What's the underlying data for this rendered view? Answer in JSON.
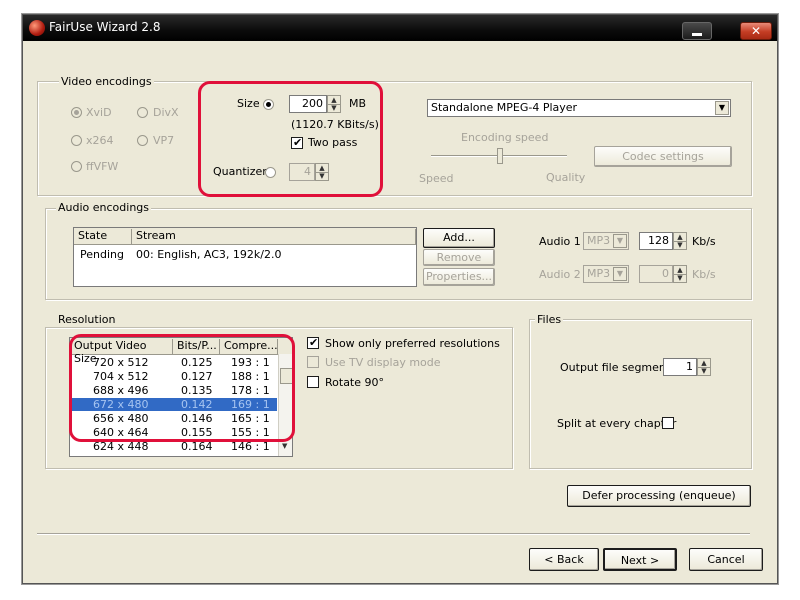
{
  "window": {
    "title": "FairUse Wizard 2.8"
  },
  "video": {
    "group_label": "Video encodings",
    "codecs": [
      {
        "label": "XviD",
        "selected": true
      },
      {
        "label": "DivX",
        "selected": false
      },
      {
        "label": "x264",
        "selected": false
      },
      {
        "label": "VP7",
        "selected": false
      },
      {
        "label": "ffVFW",
        "selected": false
      }
    ],
    "size_label": "Size",
    "size_value": "200",
    "size_unit": "MB",
    "bitrate_text": "(1120.7 KBits/s)",
    "two_pass_label": "Two pass",
    "quantizer_label": "Quantizer",
    "quantizer_value": "4",
    "profile_value": "Standalone MPEG-4 Player",
    "encoding_speed_label": "Encoding speed",
    "speed_label": "Speed",
    "quality_label": "Quality",
    "codec_settings_label": "Codec settings"
  },
  "audio": {
    "group_label": "Audio encodings",
    "columns": [
      "State",
      "Stream"
    ],
    "rows": [
      {
        "state": "Pending",
        "stream": "00: English, AC3, 192k/2.0"
      }
    ],
    "add_label": "Add...",
    "remove_label": "Remove",
    "properties_label": "Properties...",
    "audio1_label": "Audio 1",
    "audio1_codec": "MP3",
    "audio1_bitrate": "128",
    "audio1_unit": "Kb/s",
    "audio2_label": "Audio 2",
    "audio2_codec": "MP3",
    "audio2_bitrate": "0",
    "audio2_unit": "Kb/s"
  },
  "resolution": {
    "group_label": "Resolution",
    "columns": [
      "Output Video Size",
      "Bits/P...",
      "Compre..."
    ],
    "rows": [
      {
        "size": "720 x 512",
        "bits": "0.125",
        "comp": "193 : 1"
      },
      {
        "size": "704 x 512",
        "bits": "0.127",
        "comp": "188 : 1"
      },
      {
        "size": "688 x 496",
        "bits": "0.135",
        "comp": "178 : 1"
      },
      {
        "size": "672 x 480",
        "bits": "0.142",
        "comp": "169 : 1"
      },
      {
        "size": "656 x 480",
        "bits": "0.146",
        "comp": "165 : 1"
      },
      {
        "size": "640 x 464",
        "bits": "0.155",
        "comp": "155 : 1"
      },
      {
        "size": "624 x 448",
        "bits": "0.164",
        "comp": "146 : 1"
      }
    ],
    "selected_index": 3,
    "show_preferred_label": "Show only preferred resolutions",
    "tv_mode_label": "Use TV display mode",
    "rotate_label": "Rotate 90°"
  },
  "files": {
    "group_label": "Files",
    "segments_label": "Output file segments",
    "segments_value": "1",
    "split_label": "Split at every chapter"
  },
  "defer_label": "Defer processing (enqueue)",
  "nav": {
    "back_label": "< Back",
    "next_label": "Next >",
    "cancel_label": "Cancel"
  },
  "colors": {
    "annotation": "#e0103a",
    "selection": "#316ac5",
    "dialog_bg": "#ece9d8"
  }
}
